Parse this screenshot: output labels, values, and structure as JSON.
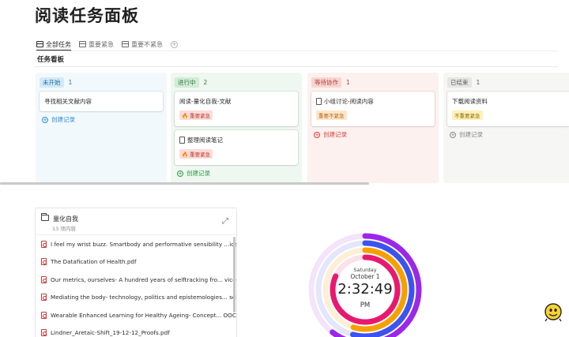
{
  "page": {
    "title": "阅读任务面板"
  },
  "tabs": [
    {
      "label": "全部任务",
      "active": true
    },
    {
      "label": "重要紧急",
      "active": false
    },
    {
      "label": "重要不紧急",
      "active": false
    }
  ],
  "section": {
    "title": "任务看板"
  },
  "board": {
    "create_label": "创建记录",
    "columns": [
      {
        "status": "未开始",
        "count": "1",
        "bg": "#f2f9fd",
        "tag_bg": "#d3e9f7",
        "tag_color": "#1f6fa8",
        "accent": "#2f8fd8",
        "cards": [
          {
            "title": "寻找相关文献内容",
            "doc_icon": false,
            "priority": ""
          }
        ]
      },
      {
        "status": "进行中",
        "count": "2",
        "bg": "#eef7f0",
        "tag_bg": "#d2ecd6",
        "tag_color": "#2b7a3a",
        "accent": "#2f9a47",
        "cards": [
          {
            "title": "阅读-量化自我-文献",
            "doc_icon": false,
            "priority": "🔥 重要紧急"
          },
          {
            "title": "整理阅读笔记",
            "doc_icon": true,
            "priority": "🔥 重要紧急"
          }
        ]
      },
      {
        "status": "等待协作",
        "count": "1",
        "bg": "#fcf1ef",
        "tag_bg": "#f7d5d0",
        "tag_color": "#b2403a",
        "accent": "#d9453e",
        "cards": [
          {
            "title": "小组讨论-阅读内容",
            "doc_icon": true,
            "priority": "重要不紧急"
          }
        ]
      },
      {
        "status": "已结束",
        "count": "1",
        "bg": "#f6f6f5",
        "tag_bg": "#e6e6e4",
        "tag_color": "#5b5b5b",
        "accent": "#8a8a8a",
        "cards": [
          {
            "title": "下载阅读资料",
            "doc_icon": false,
            "priority": "不重要紧急"
          }
        ]
      }
    ]
  },
  "folder": {
    "title": "量化自我",
    "count": "13 项内容",
    "files": [
      "I feel my wrist buzz. Smartbody and performative sensibility ...ices.pdf",
      "The Datafication of Health.pdf",
      "Our metrics, ourselves- A hundred years of selftracking fro...    vice.pdf",
      "Mediating the body- technology, politics and epistemologies...  self.pdf",
      "Wearable Enhanced Learning for Healthy Ageing- Concept...  OOC\".pdf",
      "Lindner_Aretaic-Shift_19-12-12_Proofs.pdf"
    ]
  },
  "clock": {
    "day": "Saturday",
    "date": "October 1",
    "time": "2:32:49",
    "ampm": "PM",
    "ring_fractions": {
      "day": 0.604,
      "hour": 0.542,
      "minute": 0.547,
      "second": 0.817
    },
    "colors": {
      "day": "#9b27ea",
      "hour": "#3d53f0",
      "minute": "#f5a000",
      "second": "#e9186f",
      "track": "#f1e3fb"
    }
  }
}
